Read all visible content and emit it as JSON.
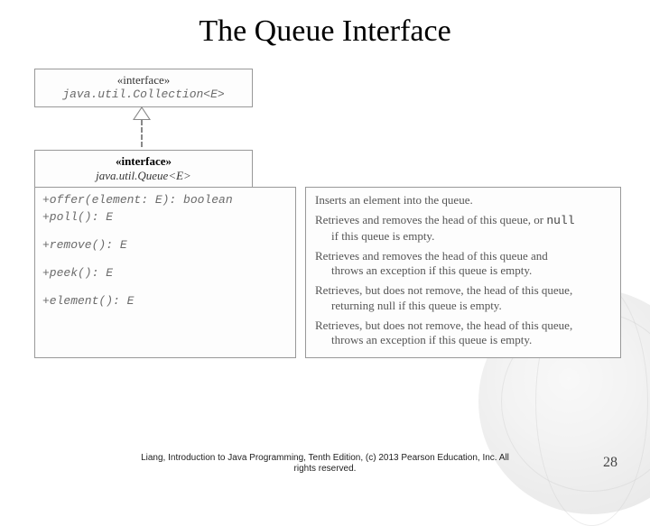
{
  "title": "The Queue Interface",
  "collection": {
    "stereotype": "«interface»",
    "name": "java.util.Collection<E>"
  },
  "queue": {
    "stereotype": "«interface»",
    "name": "java.util.Queue<E>"
  },
  "methods": {
    "offer": "+offer(element: E): boolean",
    "poll": "+poll(): E",
    "remove": "+remove(): E",
    "peek": "+peek(): E",
    "element": "+element(): E"
  },
  "descriptions": {
    "offer": "Inserts an element into the queue.",
    "poll_a": "Retrieves and removes the head of this queue, or ",
    "poll_null": "null",
    "poll_b": "if this queue is empty.",
    "remove_a": "Retrieves and removes the head of this queue and",
    "remove_b": "throws an exception if this queue is empty.",
    "peek_a": "Retrieves, but does not remove, the head of this queue,",
    "peek_b": "returning null if this queue is empty.",
    "element_a": "Retrieves, but does not remove, the head of this queue,",
    "element_b": "throws an exception if this queue is empty."
  },
  "footer": {
    "line1": "Liang, Introduction to Java Programming, Tenth Edition, (c) 2013 Pearson Education, Inc. All",
    "line2": "rights reserved."
  },
  "page": "28"
}
